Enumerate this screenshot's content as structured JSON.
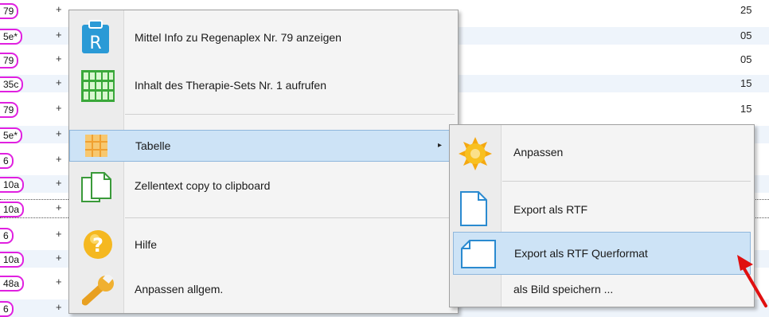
{
  "background_table": {
    "rows": [
      {
        "pill": "79",
        "plus": "+",
        "right": "25",
        "style": "normal"
      },
      {
        "pill": "5e*",
        "plus": "+",
        "right": "05",
        "style": "alt"
      },
      {
        "pill": "79",
        "plus": "+",
        "right": "05",
        "style": "normal"
      },
      {
        "pill": "35c",
        "plus": "+",
        "right": "15",
        "style": "alt"
      },
      {
        "pill": "79",
        "plus": "+",
        "right": "15",
        "style": "normal"
      },
      {
        "pill": "5e*",
        "plus": "+",
        "right": "",
        "style": "alt"
      },
      {
        "pill": "6",
        "plus": "+",
        "right": "",
        "style": "normal"
      },
      {
        "pill": "10a",
        "plus": "+",
        "right": "",
        "style": "alt"
      },
      {
        "pill": "10a",
        "plus": "+",
        "right": "",
        "style": "dotted"
      },
      {
        "pill": "6",
        "plus": "+",
        "right": "",
        "style": "normal"
      },
      {
        "pill": "10a",
        "plus": "+",
        "right": "",
        "style": "alt"
      },
      {
        "pill": "48a",
        "plus": "+",
        "right": "",
        "style": "normal"
      },
      {
        "pill": "6",
        "plus": "+",
        "right": "",
        "style": "alt"
      }
    ]
  },
  "context_menu": {
    "items": [
      {
        "label": "Mittel Info zu Regenaplex Nr. 79 anzeigen",
        "icon": "clipboard-r-icon"
      },
      {
        "label": "Inhalt des Therapie-Sets Nr. 1 aufrufen",
        "icon": "green-grid-icon"
      },
      {
        "label": "Tabelle",
        "icon": "table-grid-icon",
        "has_submenu": true,
        "highlighted": true
      },
      {
        "label": "Zellentext copy to clipboard",
        "icon": "copy-pages-icon"
      },
      {
        "label": "Hilfe",
        "icon": "help-question-icon"
      },
      {
        "label": "Anpassen allgem.",
        "icon": "wrench-icon"
      }
    ],
    "submenu_arrow": "▸"
  },
  "submenu": {
    "items": [
      {
        "label": "Anpassen",
        "icon": "sun-gear-icon"
      },
      {
        "label": "Export als RTF",
        "icon": "document-portrait-icon"
      },
      {
        "label": "Export als RTF Querformat",
        "icon": "document-landscape-icon",
        "highlighted": true
      },
      {
        "label": "als Bild speichern ...",
        "icon": ""
      }
    ]
  },
  "annotation": {
    "icon": "red-pointer-arrow-icon",
    "color": "#e01010"
  },
  "colors": {
    "highlight": "#cde3f6",
    "pill_border": "#e020e0",
    "alt_row": "#eef4fb"
  }
}
